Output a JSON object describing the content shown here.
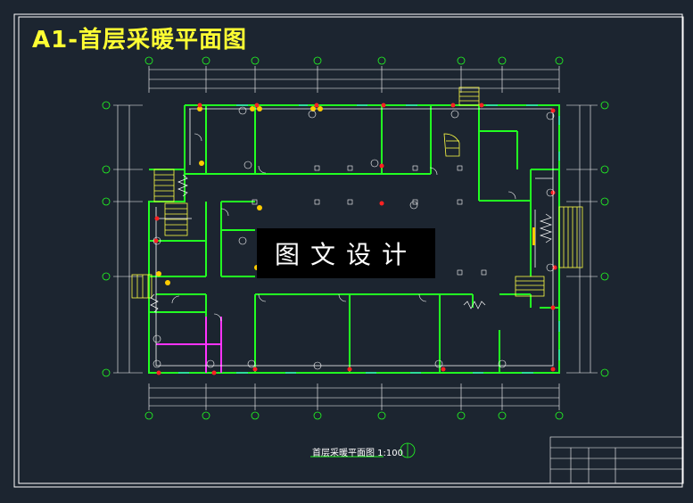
{
  "drawing": {
    "title": "A1-首层采暖平面图",
    "watermark": "图文设计",
    "plan_caption": "首层采暖平面图 1:100"
  },
  "colors": {
    "background": "#1c2530",
    "frame": "#ffffff",
    "walls": "#22ff22",
    "pipes": "#ffffff",
    "title": "#ffff33",
    "radiator": "#ffcc00",
    "valve": "#ff2222",
    "stairs": "#ffff44",
    "window": "#33cccc",
    "magenta_pipe": "#ff33ff"
  }
}
